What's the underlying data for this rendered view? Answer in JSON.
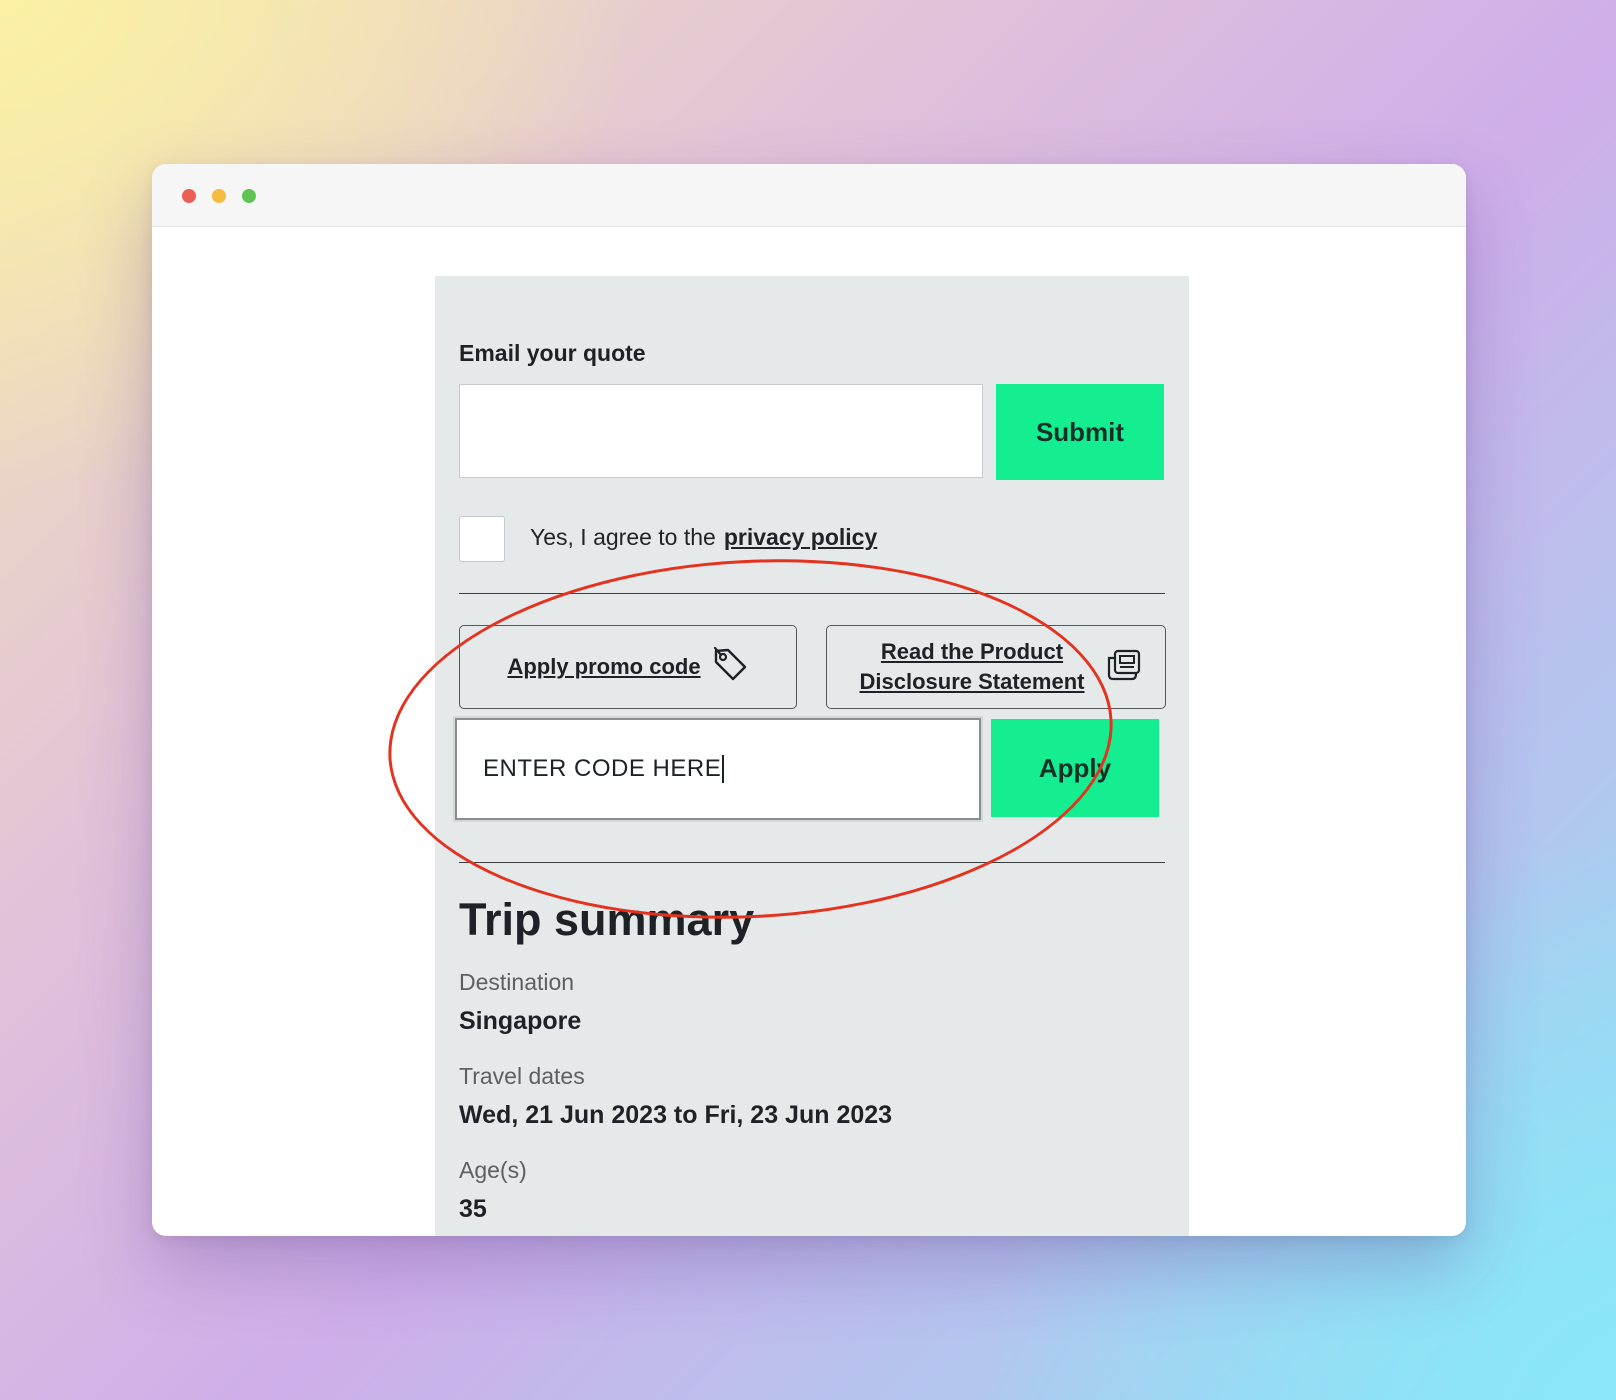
{
  "form": {
    "email_label": "Email your quote",
    "email_value": "",
    "submit_label": "Submit",
    "agree_text": "Yes, I agree to the",
    "privacy_link": "privacy policy",
    "promo_button_label": "Apply promo code",
    "pds_button_line1": "Read the Product",
    "pds_button_line2": "Disclosure Statement",
    "code_value": "ENTER CODE HERE",
    "apply_label": "Apply"
  },
  "trip": {
    "title": "Trip summary",
    "destination_label": "Destination",
    "destination_value": "Singapore",
    "dates_label": "Travel dates",
    "dates_value": "Wed, 21 Jun 2023 to Fri, 23 Jun 2023",
    "ages_label": "Age(s)",
    "ages_value": "35"
  },
  "colors": {
    "accent_green": "#14ee91",
    "annotation_red": "#e4321f",
    "panel_gray": "#e6e9ea"
  },
  "icons": [
    "tag-icon",
    "document-icon"
  ]
}
